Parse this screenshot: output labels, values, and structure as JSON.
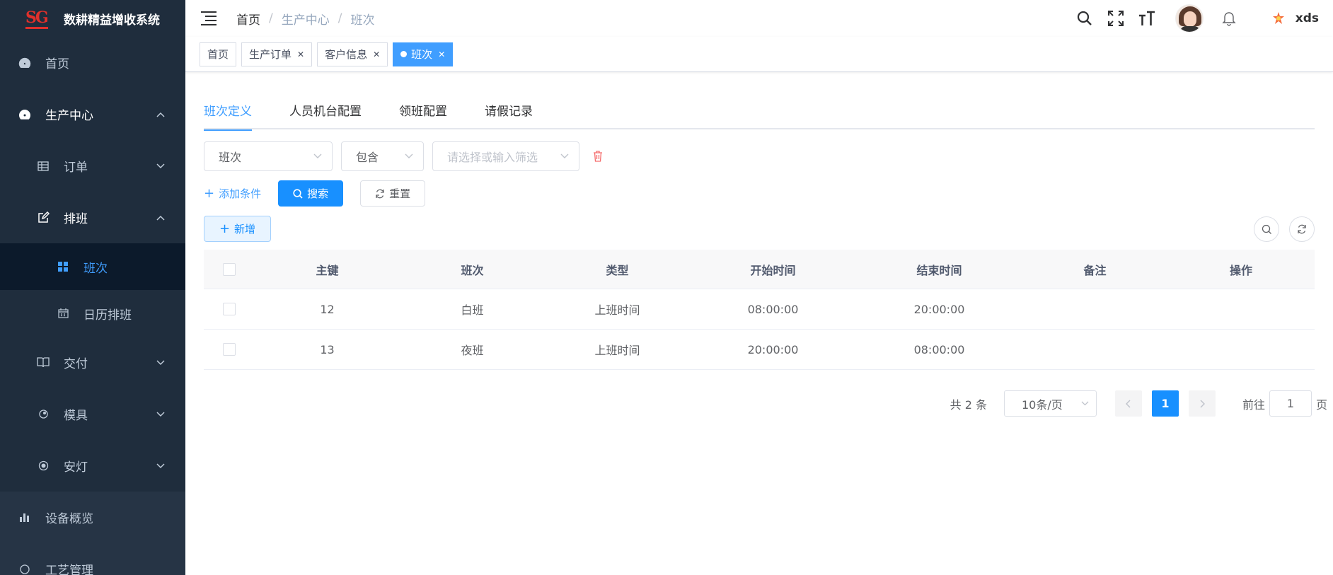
{
  "app": {
    "title": "数耕精益增收系统",
    "logo_text": "SG"
  },
  "sidebar": {
    "items": [
      {
        "label": "首页",
        "icon": "dashboard-icon"
      },
      {
        "label": "生产中心",
        "icon": "dashboard-icon"
      },
      {
        "label": "订单",
        "icon": "table-icon"
      },
      {
        "label": "排班",
        "icon": "edit-icon"
      },
      {
        "label": "班次",
        "icon": "grid-icon"
      },
      {
        "label": "日历排班",
        "icon": "calendar-icon"
      },
      {
        "label": "交付",
        "icon": "book-icon"
      },
      {
        "label": "模具",
        "icon": "mold-icon"
      },
      {
        "label": "安灯",
        "icon": "andon-icon"
      },
      {
        "label": "设备概览",
        "icon": "chart-icon"
      },
      {
        "label": "工艺管理",
        "icon": "craft-icon"
      }
    ]
  },
  "header": {
    "breadcrumb": [
      "首页",
      "生产中心",
      "班次"
    ],
    "username": "xds"
  },
  "tags": [
    {
      "label": "首页"
    },
    {
      "label": "生产订单"
    },
    {
      "label": "客户信息"
    },
    {
      "label": "班次"
    }
  ],
  "tabs": [
    "班次定义",
    "人员机台配置",
    "领班配置",
    "请假记录"
  ],
  "filter": {
    "field": "班次",
    "operator": "包含",
    "value_placeholder": "请选择或输入筛选"
  },
  "actions": {
    "add_condition": "添加条件",
    "search": "搜索",
    "reset": "重置",
    "add": "新增"
  },
  "table": {
    "columns": [
      "主键",
      "班次",
      "类型",
      "开始时间",
      "结束时间",
      "备注",
      "操作"
    ],
    "rows": [
      {
        "id": "12",
        "shift": "白班",
        "type": "上班时间",
        "start": "08:00:00",
        "end": "20:00:00",
        "remark": "",
        "op": ""
      },
      {
        "id": "13",
        "shift": "夜班",
        "type": "上班时间",
        "start": "20:00:00",
        "end": "08:00:00",
        "remark": "",
        "op": ""
      }
    ]
  },
  "pagination": {
    "total_text": "共 2 条",
    "page_size": "10条/页",
    "current_page": "1",
    "goto_label": "前往",
    "goto_value": "1",
    "page_unit": "页"
  },
  "colors": {
    "primary": "#1890ff",
    "sidebar_bg": "#1f2d3d",
    "active_link": "#409eff"
  }
}
